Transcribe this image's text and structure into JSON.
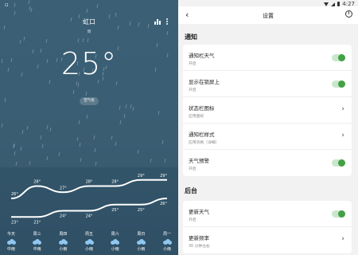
{
  "status": {
    "time": "4:27"
  },
  "weather": {
    "city": "虹口",
    "condition": "雨",
    "temperature": "25°",
    "aqi_label": "空气优",
    "high_temps": [
      "26°",
      "28°",
      "27°",
      "28°",
      "28°",
      "29°",
      "29°"
    ],
    "low_temps": [
      "23°",
      "23°",
      "24°",
      "24°",
      "25°",
      "25°",
      "26°"
    ],
    "days": [
      {
        "name": "今天",
        "condition": "中雨"
      },
      {
        "name": "周三",
        "condition": "中雨"
      },
      {
        "name": "周四",
        "condition": "小雨"
      },
      {
        "name": "周五",
        "condition": "小雨"
      },
      {
        "name": "周六",
        "condition": "小雨"
      },
      {
        "name": "周日",
        "condition": "小雨"
      },
      {
        "name": "周一",
        "condition": "小雨"
      }
    ]
  },
  "settings": {
    "title": "设置",
    "sections": [
      {
        "title": "通知",
        "items": [
          {
            "title": "通知栏天气",
            "subtitle": "开启",
            "control": "toggle",
            "on": true
          },
          {
            "title": "显示在锁屏上",
            "subtitle": "开启",
            "control": "toggle",
            "on": true
          },
          {
            "title": "状态栏图标",
            "subtitle": "应用图标",
            "control": "chevron"
          },
          {
            "title": "通知栏样式",
            "subtitle": "应用风格（详细）",
            "control": "chevron"
          },
          {
            "title": "天气预警",
            "subtitle": "开启",
            "control": "toggle",
            "on": true
          }
        ]
      },
      {
        "title": "后台",
        "items": [
          {
            "title": "更新天气",
            "subtitle": "开启",
            "control": "toggle",
            "on": true
          },
          {
            "title": "更新频率",
            "subtitle": "30 分钟左右",
            "control": "chevron"
          }
        ]
      }
    ]
  },
  "colors": {
    "toggle_on": "#43a047",
    "weather_bg": "#3b6076",
    "cloud": "#8fc7f0"
  }
}
